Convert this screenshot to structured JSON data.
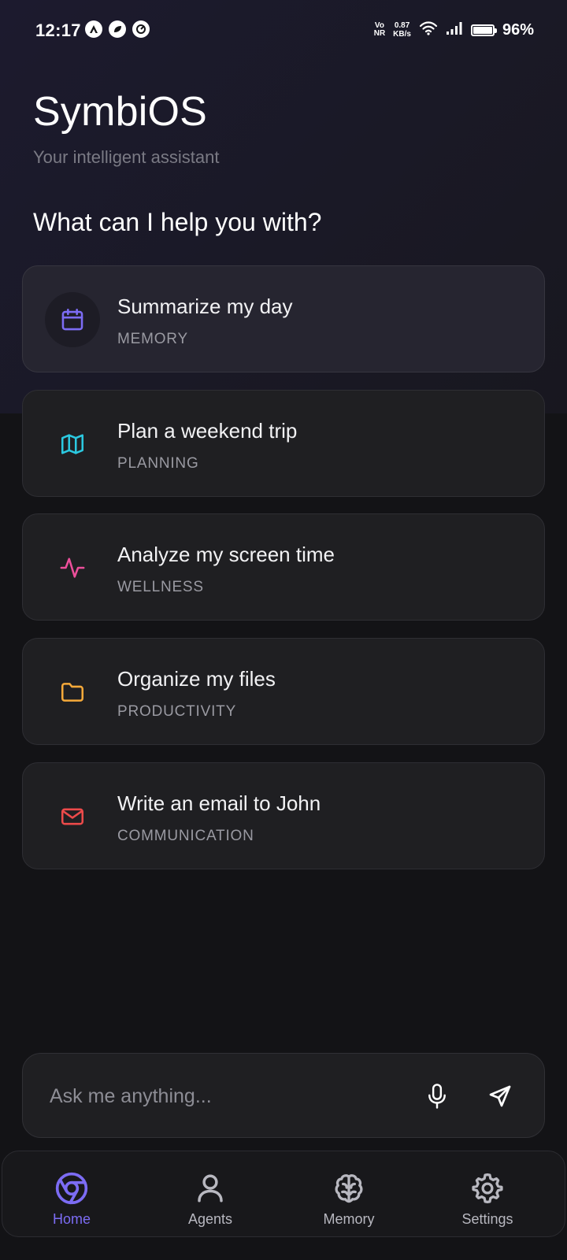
{
  "status_bar": {
    "time": "12:17",
    "vo_line1": "Vo",
    "vo_line2": "NR",
    "net_speed_value": "0.87",
    "net_speed_unit": "KB/s",
    "battery_percent": "96%"
  },
  "header": {
    "title": "SymbiOS",
    "subtitle": "Your intelligent assistant",
    "prompt": "What can I help you with?"
  },
  "suggestions": [
    {
      "title": "Summarize my day",
      "category": "MEMORY",
      "icon": "calendar-icon",
      "color": "#7c6cf4"
    },
    {
      "title": "Plan a weekend trip",
      "category": "PLANNING",
      "icon": "map-icon",
      "color": "#2bc8e0"
    },
    {
      "title": "Analyze my screen time",
      "category": "WELLNESS",
      "icon": "activity-icon",
      "color": "#ec4f9b"
    },
    {
      "title": "Organize my files",
      "category": "PRODUCTIVITY",
      "icon": "folder-icon",
      "color": "#f5a93a"
    },
    {
      "title": "Write an email to John",
      "category": "COMMUNICATION",
      "icon": "mail-icon",
      "color": "#ec4a4a"
    }
  ],
  "input": {
    "placeholder": "Ask me anything...",
    "value": ""
  },
  "nav": {
    "items": [
      {
        "label": "Home",
        "icon": "home-chrome-icon",
        "active": true
      },
      {
        "label": "Agents",
        "icon": "user-icon",
        "active": false
      },
      {
        "label": "Memory",
        "icon": "brain-icon",
        "active": false
      },
      {
        "label": "Settings",
        "icon": "gear-icon",
        "active": false
      }
    ]
  },
  "colors": {
    "accent": "#7c6cf4",
    "background": "#131316",
    "card": "#1f1f22"
  }
}
